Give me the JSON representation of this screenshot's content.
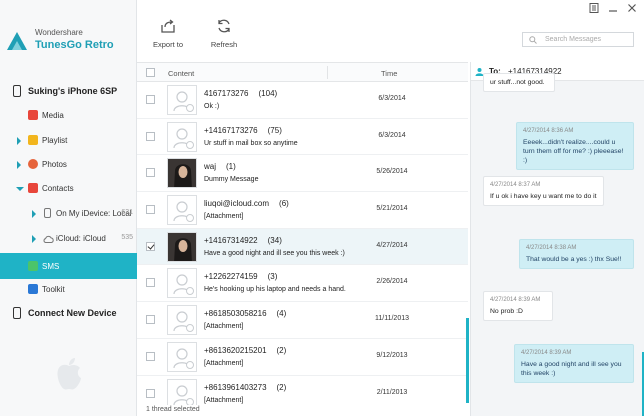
{
  "app": {
    "brand_top": "Wondershare",
    "brand_name": "TunesGo Retro",
    "accent": "#1fb3c6"
  },
  "sidebar": {
    "device": "Suking's iPhone 6SP",
    "items": [
      {
        "label": "Media",
        "icon": "media-icon",
        "color": "#e8463b"
      },
      {
        "label": "Playlist",
        "icon": "playlist-icon",
        "color": "#f2b51d"
      },
      {
        "label": "Photos",
        "icon": "photos-icon",
        "color": "#e6643c"
      },
      {
        "label": "Contacts",
        "icon": "contacts-icon",
        "color": "#e8463b"
      },
      {
        "label": "On My iDevice: Local",
        "count": "631",
        "icon": "device-local-icon"
      },
      {
        "label": "iCloud: iCloud",
        "count": "535",
        "icon": "cloud-icon"
      },
      {
        "label": "SMS",
        "icon": "sms-icon",
        "color": "#4bc46a"
      },
      {
        "label": "Toolkit",
        "icon": "toolkit-icon",
        "color": "#2a78d6"
      }
    ],
    "connect_label": "Connect New Device"
  },
  "toolbar": {
    "export_label": "Export to",
    "refresh_label": "Refresh",
    "search_placeholder": "Search Messages"
  },
  "list": {
    "col_content": "Content",
    "col_time": "Time",
    "rows": [
      {
        "contact": "4167173276",
        "count": "(104)",
        "snippet": "Ok :)",
        "time": "6/3/2014",
        "photo": false,
        "checked": false
      },
      {
        "contact": "+14167173276",
        "count": "(75)",
        "snippet": "Ur stuff in mail box so anytime",
        "time": "6/3/2014",
        "photo": false,
        "checked": false
      },
      {
        "contact": "waj",
        "count": "(1)",
        "snippet": "Dummy Message",
        "time": "5/26/2014",
        "photo": true,
        "checked": false
      },
      {
        "contact": "liuqoi@icloud.com",
        "count": "(6)",
        "snippet": "[Attachment]",
        "time": "5/21/2014",
        "photo": false,
        "checked": false
      },
      {
        "contact": "+14167314922",
        "count": "(34)",
        "snippet": "Have a good night and ill see you this week :)",
        "time": "4/27/2014",
        "photo": true,
        "checked": true
      },
      {
        "contact": "+12262274159",
        "count": "(3)",
        "snippet": "He's hooking up his laptop and needs a hand.",
        "time": "2/26/2014",
        "photo": false,
        "checked": false
      },
      {
        "contact": "+8618503058216",
        "count": "(4)",
        "snippet": "[Attachment]",
        "time": "11/11/2013",
        "photo": false,
        "checked": false
      },
      {
        "contact": "+8613620215201",
        "count": "(2)",
        "snippet": "[Attachment]",
        "time": "9/12/2013",
        "photo": false,
        "checked": false
      },
      {
        "contact": "+8613961403273",
        "count": "(2)",
        "snippet": "[Attachment]",
        "time": "2/11/2013",
        "photo": false,
        "checked": false
      }
    ],
    "status": "1 thread selected"
  },
  "conversation": {
    "to_label": "To:",
    "to_number": "+14167314922",
    "messages": [
      {
        "dir": "in",
        "time": "",
        "text": "ur stuff...not good."
      },
      {
        "dir": "out",
        "time": "4/27/2014 8:36 AM",
        "text": "Eeeek...didn't realize....could u turn them off for me? :) pleeease! :)"
      },
      {
        "dir": "in",
        "time": "4/27/2014 8:37 AM",
        "text": "If u ok i have key u want me to do it"
      },
      {
        "dir": "out",
        "time": "4/27/2014 8:38 AM",
        "text": "That would be a yes :) thx Sue!!"
      },
      {
        "dir": "in",
        "time": "4/27/2014 8:39 AM",
        "text": "No prob :D"
      },
      {
        "dir": "out",
        "time": "4/27/2014 8:39 AM",
        "text": "Have a good night and ill see you this week :)"
      }
    ]
  }
}
